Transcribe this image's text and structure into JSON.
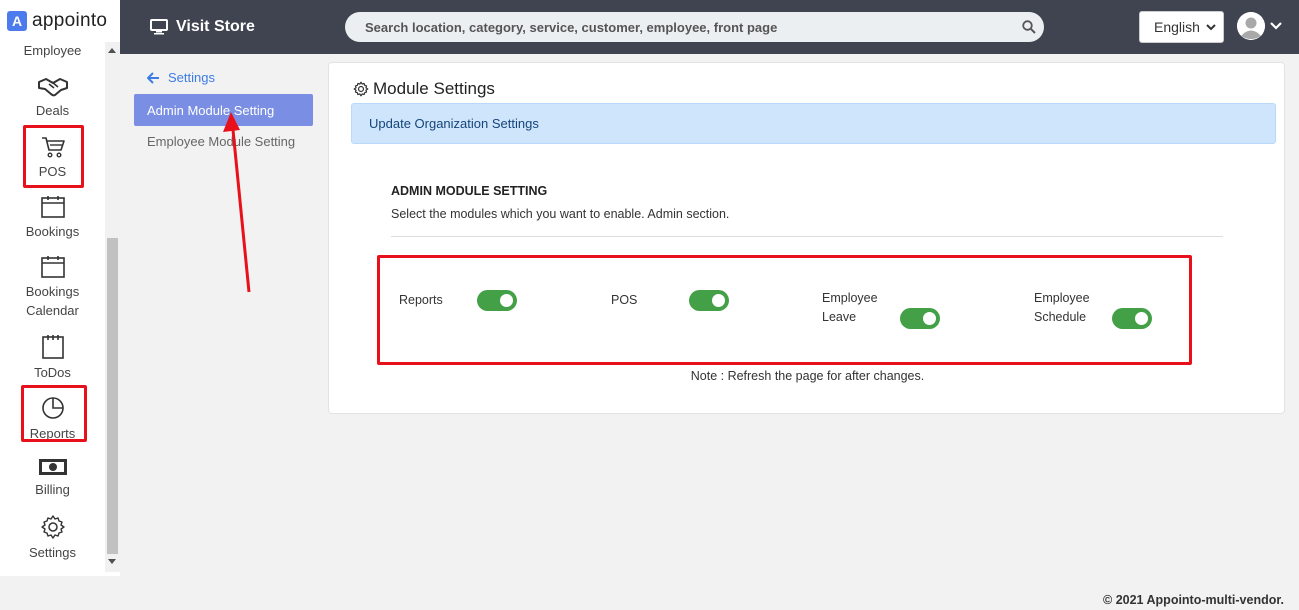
{
  "brand": {
    "logo_letter": "A",
    "name": "appointo"
  },
  "sidebar": {
    "items": [
      {
        "label": "Employee",
        "icon": "employee-icon"
      },
      {
        "label": "Deals",
        "icon": "handshake-icon"
      },
      {
        "label": "POS",
        "icon": "cart-icon"
      },
      {
        "label": "Bookings",
        "icon": "calendar-icon"
      },
      {
        "label": "Bookings Calendar",
        "icon": "calendar-icon"
      },
      {
        "label": "ToDos",
        "icon": "todo-icon"
      },
      {
        "label": "Reports",
        "icon": "pie-chart-icon"
      },
      {
        "label": "Billing",
        "icon": "money-icon"
      },
      {
        "label": "Settings",
        "icon": "gear-icon"
      }
    ]
  },
  "topbar": {
    "visit_store": "Visit Store",
    "search_placeholder": "Search location, category, service, customer, employee, front page",
    "language": "English"
  },
  "settings_nav": {
    "back_label": "Settings",
    "active_item": "Admin Module Setting",
    "other_item": "Employee Module Setting"
  },
  "card": {
    "title": "Module Settings",
    "alert": "Update Organization Settings",
    "section_title": "ADMIN MODULE SETTING",
    "section_desc": "Select the modules which you want to enable. Admin section.",
    "modules": [
      {
        "label": "Reports",
        "enabled": true
      },
      {
        "label": "POS",
        "enabled": true
      },
      {
        "label_line1": "Employee",
        "label_line2": "Leave",
        "enabled": true
      },
      {
        "label_line1": "Employee",
        "label_line2": "Schedule",
        "enabled": true
      }
    ],
    "note": "Note : Refresh the page for after changes."
  },
  "footer": "© 2021 Appointo-multi-vendor.",
  "colors": {
    "accent": "#7a8fe4",
    "toggle_on": "#43a047",
    "highlight": "#e8101b",
    "topbar": "#3f4450"
  }
}
